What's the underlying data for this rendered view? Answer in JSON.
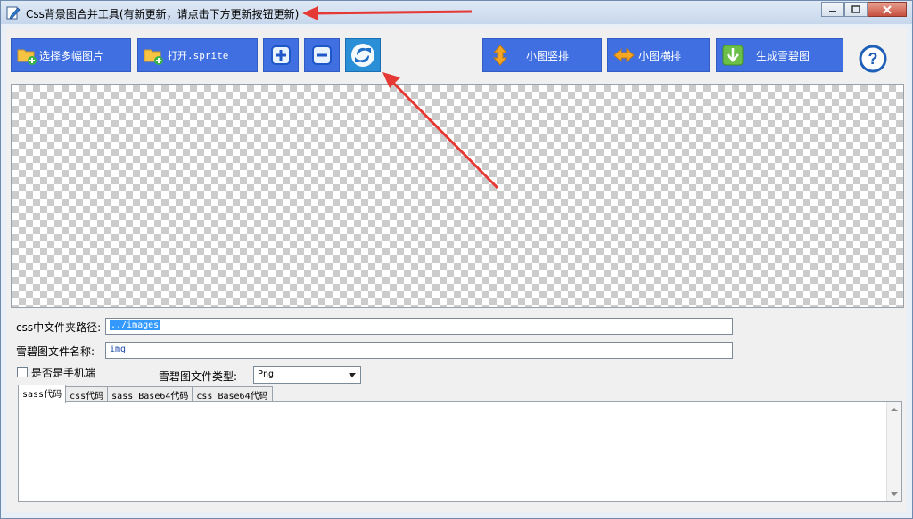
{
  "window": {
    "title": "Css背景图合并工具(有新更新，请点击下方更新按钮更新)"
  },
  "toolbar": {
    "select_images": "选择多幅图片",
    "open_sprite": "打开.sprite",
    "vertical": "小图竖排",
    "horizontal": "小图横排",
    "generate": "生成雪碧图"
  },
  "form": {
    "folder_label": "css中文件夹路径:",
    "folder_value": "../images",
    "name_label": "雪碧图文件名称:",
    "name_value": "img",
    "mobile_label": "是否是手机端",
    "type_label": "雪碧图文件类型:",
    "type_value": "Png"
  },
  "tabs": [
    {
      "label": "sass代码"
    },
    {
      "label": "css代码"
    },
    {
      "label": "sass Base64代码"
    },
    {
      "label": "css Base64代码"
    }
  ],
  "colors": {
    "button_blue": "#3f6fe0",
    "annotation_red": "#e53935"
  }
}
